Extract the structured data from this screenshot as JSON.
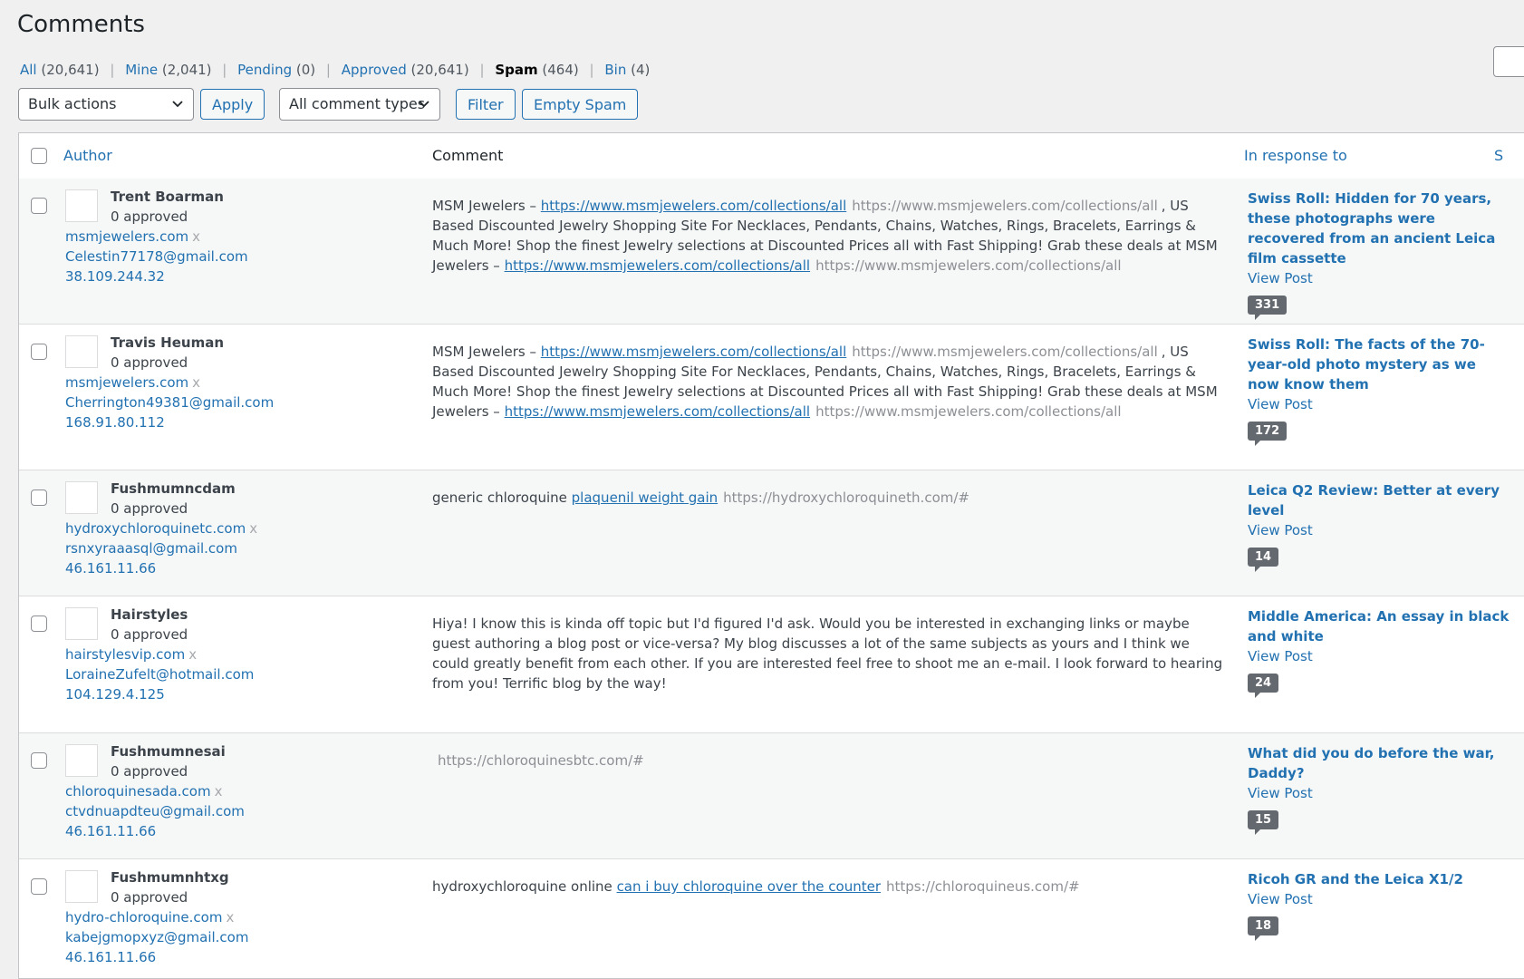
{
  "page": {
    "title": "Comments"
  },
  "filters": [
    {
      "label": "All",
      "count": "(20,641)",
      "current": false
    },
    {
      "label": "Mine",
      "count": "(2,041)",
      "current": false
    },
    {
      "label": "Pending",
      "count": "(0)",
      "current": false
    },
    {
      "label": "Approved",
      "count": "(20,641)",
      "current": false
    },
    {
      "label": "Spam",
      "count": "(464)",
      "current": true
    },
    {
      "label": "Bin",
      "count": "(4)",
      "current": false
    }
  ],
  "toolbar": {
    "bulk_actions": "Bulk actions",
    "apply": "Apply",
    "comment_types": "All comment types",
    "filter": "Filter",
    "empty_spam": "Empty Spam"
  },
  "table": {
    "col_author": "Author",
    "col_comment": "Comment",
    "col_response": "In response to",
    "col_submitted_clip": "S"
  },
  "rows": [
    {
      "name": "Trent Boarman",
      "approved": "0 approved",
      "site": "msmjewelers.com",
      "x": "x",
      "email": "Celestin77178@gmail.com",
      "ip": "38.109.244.32",
      "c1": "MSM Jewelers – ",
      "c1_link": "https://www.msmjewelers.com/collections/all",
      "c1_url": "https://www.msmjewelers.com/collections/all",
      "c2": ", US Based Discounted Jewelry Shopping Site For Necklaces, Pendants, Chains, Watches, Rings, Bracelets, Earrings & Much More! Shop the finest Jewelry selections at Discounted Prices all with Fast Shipping! Grab these deals at MSM Jewelers – ",
      "c2_link": "https://www.msmjewelers.com/collections/all",
      "c2_url": "https://www.msmjewelers.com/collections/all",
      "post": "Swiss Roll: Hidden for 70 years, these photographs were recovered from an ancient Leica film cassette",
      "view": "View Post",
      "count": "331",
      "clip": "2"
    },
    {
      "name": "Travis Heuman",
      "approved": "0 approved",
      "site": "msmjewelers.com",
      "x": "x",
      "email": "Cherrington49381@gmail.com",
      "ip": "168.91.80.112",
      "c1": "MSM Jewelers – ",
      "c1_link": "https://www.msmjewelers.com/collections/all",
      "c1_url": "https://www.msmjewelers.com/collections/all",
      "c2": ", US Based Discounted Jewelry Shopping Site For Necklaces, Pendants, Chains, Watches, Rings, Bracelets, Earrings & Much More! Shop the finest Jewelry selections at Discounted Prices all with Fast Shipping! Grab these deals at MSM Jewelers – ",
      "c2_link": "https://www.msmjewelers.com/collections/all",
      "c2_url": "https://www.msmjewelers.com/collections/all",
      "post": "Swiss Roll: The facts of the 70-year-old photo mystery as we now know them",
      "view": "View Post",
      "count": "172",
      "clip": "2"
    },
    {
      "name": "Fushmumncdam",
      "approved": "0 approved",
      "site": "hydroxychloroquinetc.com",
      "x": "x",
      "email": "rsnxyraaasql@gmail.com",
      "ip": "46.161.11.66",
      "c1": "generic chloroquine ",
      "c1_link": "plaquenil weight gain",
      "c1_url": "https://hydroxychloroquineth.com/#",
      "c2": "",
      "c2_link": "",
      "c2_url": "",
      "post": "Leica Q2 Review: Better at every level",
      "view": "View Post",
      "count": "14",
      "clip": "2"
    },
    {
      "name": "Hairstyles",
      "approved": "0 approved",
      "site": "hairstylesvip.com",
      "x": "x",
      "email": "LoraineZufelt@hotmail.com",
      "ip": "104.129.4.125",
      "c1": "Hiya! I know this is kinda off topic but I'd figured I'd ask. Would you be interested in exchanging links or maybe guest authoring a blog post or vice-versa? My blog discusses a lot of the same subjects as yours and I think we could greatly benefit from each other. If you are interested feel free to shoot me an e-mail. I look forward to hearing from you! Terrific blog by the way!",
      "c1_link": "",
      "c1_url": "",
      "c2": "",
      "c2_link": "",
      "c2_url": "",
      "post": "Middle America: An essay in black and white",
      "view": "View Post",
      "count": "24",
      "clip": "2"
    },
    {
      "name": "Fushmumnesai",
      "approved": "0 approved",
      "site": "chloroquinesada.com",
      "x": "x",
      "email": "ctvdnuapdteu@gmail.com",
      "ip": "46.161.11.66",
      "c1": "",
      "c1_link": "",
      "c1_url": "https://chloroquinesbtc.com/#",
      "c2": "",
      "c2_link": "",
      "c2_url": "",
      "post": "What did you do before the war, Daddy?",
      "view": "View Post",
      "count": "15",
      "clip": "2"
    },
    {
      "name": "Fushmumnhtxg",
      "approved": "0 approved",
      "site": "hydro-chloroquine.com",
      "x": "x",
      "email": "kabejgmopxyz@gmail.com",
      "ip": "46.161.11.66",
      "c1": "hydroxychloroquine online ",
      "c1_link": "can i buy chloroquine over the counter",
      "c1_url": "https://chloroquineus.com/#",
      "c2": "",
      "c2_link": "",
      "c2_url": "",
      "post": "Ricoh GR and the Leica X1/2",
      "view": "View Post",
      "count": "18",
      "clip": "2"
    }
  ]
}
